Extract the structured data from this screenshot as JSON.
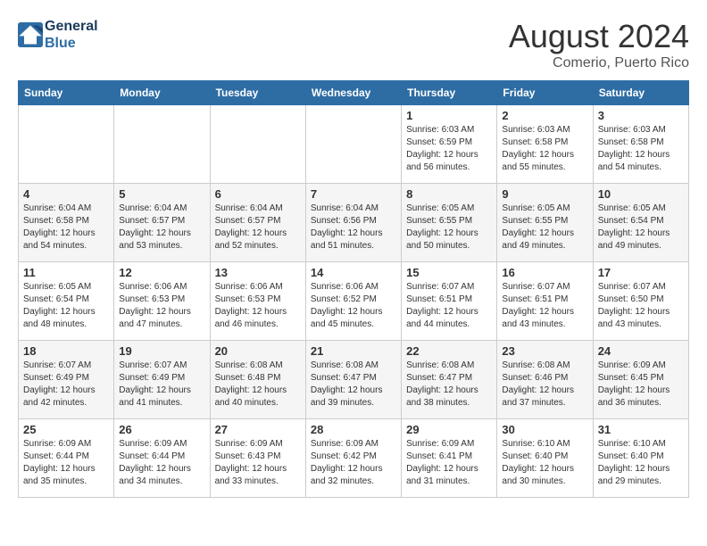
{
  "header": {
    "logo_line1": "General",
    "logo_line2": "Blue",
    "month_title": "August 2024",
    "subtitle": "Comerio, Puerto Rico"
  },
  "days_of_week": [
    "Sunday",
    "Monday",
    "Tuesday",
    "Wednesday",
    "Thursday",
    "Friday",
    "Saturday"
  ],
  "weeks": [
    [
      {
        "day": "",
        "info": ""
      },
      {
        "day": "",
        "info": ""
      },
      {
        "day": "",
        "info": ""
      },
      {
        "day": "",
        "info": ""
      },
      {
        "day": "1",
        "info": "Sunrise: 6:03 AM\nSunset: 6:59 PM\nDaylight: 12 hours\nand 56 minutes."
      },
      {
        "day": "2",
        "info": "Sunrise: 6:03 AM\nSunset: 6:58 PM\nDaylight: 12 hours\nand 55 minutes."
      },
      {
        "day": "3",
        "info": "Sunrise: 6:03 AM\nSunset: 6:58 PM\nDaylight: 12 hours\nand 54 minutes."
      }
    ],
    [
      {
        "day": "4",
        "info": "Sunrise: 6:04 AM\nSunset: 6:58 PM\nDaylight: 12 hours\nand 54 minutes."
      },
      {
        "day": "5",
        "info": "Sunrise: 6:04 AM\nSunset: 6:57 PM\nDaylight: 12 hours\nand 53 minutes."
      },
      {
        "day": "6",
        "info": "Sunrise: 6:04 AM\nSunset: 6:57 PM\nDaylight: 12 hours\nand 52 minutes."
      },
      {
        "day": "7",
        "info": "Sunrise: 6:04 AM\nSunset: 6:56 PM\nDaylight: 12 hours\nand 51 minutes."
      },
      {
        "day": "8",
        "info": "Sunrise: 6:05 AM\nSunset: 6:55 PM\nDaylight: 12 hours\nand 50 minutes."
      },
      {
        "day": "9",
        "info": "Sunrise: 6:05 AM\nSunset: 6:55 PM\nDaylight: 12 hours\nand 49 minutes."
      },
      {
        "day": "10",
        "info": "Sunrise: 6:05 AM\nSunset: 6:54 PM\nDaylight: 12 hours\nand 49 minutes."
      }
    ],
    [
      {
        "day": "11",
        "info": "Sunrise: 6:05 AM\nSunset: 6:54 PM\nDaylight: 12 hours\nand 48 minutes."
      },
      {
        "day": "12",
        "info": "Sunrise: 6:06 AM\nSunset: 6:53 PM\nDaylight: 12 hours\nand 47 minutes."
      },
      {
        "day": "13",
        "info": "Sunrise: 6:06 AM\nSunset: 6:53 PM\nDaylight: 12 hours\nand 46 minutes."
      },
      {
        "day": "14",
        "info": "Sunrise: 6:06 AM\nSunset: 6:52 PM\nDaylight: 12 hours\nand 45 minutes."
      },
      {
        "day": "15",
        "info": "Sunrise: 6:07 AM\nSunset: 6:51 PM\nDaylight: 12 hours\nand 44 minutes."
      },
      {
        "day": "16",
        "info": "Sunrise: 6:07 AM\nSunset: 6:51 PM\nDaylight: 12 hours\nand 43 minutes."
      },
      {
        "day": "17",
        "info": "Sunrise: 6:07 AM\nSunset: 6:50 PM\nDaylight: 12 hours\nand 43 minutes."
      }
    ],
    [
      {
        "day": "18",
        "info": "Sunrise: 6:07 AM\nSunset: 6:49 PM\nDaylight: 12 hours\nand 42 minutes."
      },
      {
        "day": "19",
        "info": "Sunrise: 6:07 AM\nSunset: 6:49 PM\nDaylight: 12 hours\nand 41 minutes."
      },
      {
        "day": "20",
        "info": "Sunrise: 6:08 AM\nSunset: 6:48 PM\nDaylight: 12 hours\nand 40 minutes."
      },
      {
        "day": "21",
        "info": "Sunrise: 6:08 AM\nSunset: 6:47 PM\nDaylight: 12 hours\nand 39 minutes."
      },
      {
        "day": "22",
        "info": "Sunrise: 6:08 AM\nSunset: 6:47 PM\nDaylight: 12 hours\nand 38 minutes."
      },
      {
        "day": "23",
        "info": "Sunrise: 6:08 AM\nSunset: 6:46 PM\nDaylight: 12 hours\nand 37 minutes."
      },
      {
        "day": "24",
        "info": "Sunrise: 6:09 AM\nSunset: 6:45 PM\nDaylight: 12 hours\nand 36 minutes."
      }
    ],
    [
      {
        "day": "25",
        "info": "Sunrise: 6:09 AM\nSunset: 6:44 PM\nDaylight: 12 hours\nand 35 minutes."
      },
      {
        "day": "26",
        "info": "Sunrise: 6:09 AM\nSunset: 6:44 PM\nDaylight: 12 hours\nand 34 minutes."
      },
      {
        "day": "27",
        "info": "Sunrise: 6:09 AM\nSunset: 6:43 PM\nDaylight: 12 hours\nand 33 minutes."
      },
      {
        "day": "28",
        "info": "Sunrise: 6:09 AM\nSunset: 6:42 PM\nDaylight: 12 hours\nand 32 minutes."
      },
      {
        "day": "29",
        "info": "Sunrise: 6:09 AM\nSunset: 6:41 PM\nDaylight: 12 hours\nand 31 minutes."
      },
      {
        "day": "30",
        "info": "Sunrise: 6:10 AM\nSunset: 6:40 PM\nDaylight: 12 hours\nand 30 minutes."
      },
      {
        "day": "31",
        "info": "Sunrise: 6:10 AM\nSunset: 6:40 PM\nDaylight: 12 hours\nand 29 minutes."
      }
    ]
  ]
}
